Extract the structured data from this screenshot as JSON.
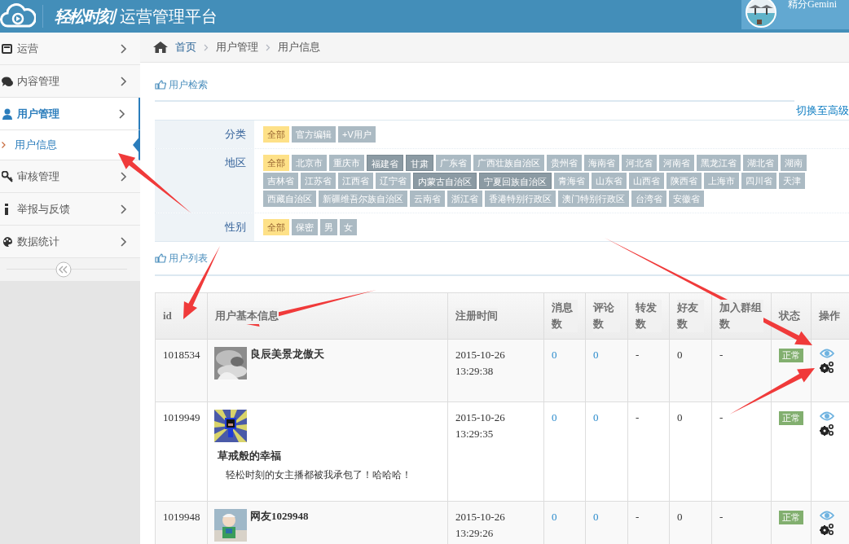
{
  "header": {
    "logo": "轻松时刻",
    "title": "运营管理平台",
    "user": "精分Gemini"
  },
  "sidebar": {
    "items": [
      {
        "label": "运营",
        "selected": false
      },
      {
        "label": "内容管理",
        "selected": false
      },
      {
        "label": "用户管理",
        "selected": true,
        "children": [
          {
            "label": "用户信息",
            "selected": true
          }
        ]
      },
      {
        "label": "审核管理",
        "selected": false
      },
      {
        "label": "举报与反馈",
        "selected": false
      },
      {
        "label": "数据统计",
        "selected": false
      }
    ]
  },
  "breadcrumb": [
    "首页",
    "用户管理",
    "用户信息"
  ],
  "search": {
    "title": "用户检索",
    "switch_link": "切换至高级",
    "filters": [
      {
        "label": "分类",
        "tags": [
          {
            "label": "全部",
            "kind": "all",
            "selected": true
          },
          {
            "label": "官方编辑",
            "kind": "option",
            "selected": false
          },
          {
            "label": "+V用户",
            "kind": "option",
            "selected": false
          }
        ]
      },
      {
        "label": "地区",
        "tags": [
          {
            "label": "全部",
            "kind": "all",
            "selected": true
          },
          {
            "label": "北京市",
            "kind": "option",
            "selected": false
          },
          {
            "label": "重庆市",
            "kind": "option",
            "selected": false
          },
          {
            "label": "福建省",
            "kind": "option",
            "selected": true
          },
          {
            "label": "甘肃",
            "kind": "option",
            "selected": true
          },
          {
            "label": "广东省",
            "kind": "option",
            "selected": false
          },
          {
            "label": "广西壮族自治区",
            "kind": "option",
            "selected": false
          },
          {
            "label": "贵州省",
            "kind": "option",
            "selected": false
          },
          {
            "label": "海南省",
            "kind": "option",
            "selected": false
          },
          {
            "label": "河北省",
            "kind": "option",
            "selected": false
          },
          {
            "label": "河南省",
            "kind": "option",
            "selected": false
          },
          {
            "label": "黑龙江省",
            "kind": "option",
            "selected": false
          },
          {
            "label": "湖北省",
            "kind": "option",
            "selected": false
          },
          {
            "label": "湖南",
            "kind": "option",
            "selected": false
          },
          {
            "label": "吉林省",
            "kind": "option",
            "selected": false
          },
          {
            "label": "江苏省",
            "kind": "option",
            "selected": false
          },
          {
            "label": "江西省",
            "kind": "option",
            "selected": false
          },
          {
            "label": "辽宁省",
            "kind": "option",
            "selected": false
          },
          {
            "label": "内蒙古自治区",
            "kind": "option",
            "selected": true
          },
          {
            "label": "宁夏回族自治区",
            "kind": "option",
            "selected": true
          },
          {
            "label": "青海省",
            "kind": "option",
            "selected": false
          },
          {
            "label": "山东省",
            "kind": "option",
            "selected": false
          },
          {
            "label": "山西省",
            "kind": "option",
            "selected": false
          },
          {
            "label": "陕西省",
            "kind": "option",
            "selected": false
          },
          {
            "label": "上海市",
            "kind": "option",
            "selected": false
          },
          {
            "label": "四川省",
            "kind": "option",
            "selected": false
          },
          {
            "label": "天津",
            "kind": "option",
            "selected": false
          },
          {
            "label": "西藏自治区",
            "kind": "option",
            "selected": false
          },
          {
            "label": "新疆维吾尔族自治区",
            "kind": "option",
            "selected": false
          },
          {
            "label": "云南省",
            "kind": "option",
            "selected": false
          },
          {
            "label": "浙江省",
            "kind": "option",
            "selected": false
          },
          {
            "label": "香港特别行政区",
            "kind": "option",
            "selected": false
          },
          {
            "label": "澳门特别行政区",
            "kind": "option",
            "selected": false
          },
          {
            "label": "台湾省",
            "kind": "option",
            "selected": false
          },
          {
            "label": "安徽省",
            "kind": "option",
            "selected": false
          }
        ]
      },
      {
        "label": "性别",
        "tags": [
          {
            "label": "全部",
            "kind": "all",
            "selected": true
          },
          {
            "label": "保密",
            "kind": "option",
            "selected": false
          },
          {
            "label": "男",
            "kind": "option",
            "selected": false
          },
          {
            "label": "女",
            "kind": "option",
            "selected": false
          }
        ]
      }
    ]
  },
  "list_title": "用户列表",
  "table": {
    "columns": [
      "id",
      "用户基本信息",
      "注册时间",
      "消息数",
      "评论数",
      "转发数",
      "好友数",
      "加入群组数",
      "状态",
      "操作"
    ],
    "rows": [
      {
        "id": "1018534",
        "name": "良辰美景龙傲天",
        "date": "2015-10-26",
        "time": "13:29:38",
        "messages": "0",
        "comments": "0",
        "forwards": "-",
        "friends": "0",
        "groups": "-",
        "status": "正常"
      },
      {
        "id": "1019949",
        "name": "草戒般的幸福",
        "bio": "轻松时刻的女主播都被我承包了！哈哈哈！",
        "date": "2015-10-26",
        "time": "13:29:35",
        "messages": "0",
        "comments": "0",
        "forwards": "-",
        "friends": "0",
        "groups": "-",
        "status": "正常"
      },
      {
        "id": "1019948",
        "name": "网友1029948",
        "date": "2015-10-26",
        "time": "13:29:26",
        "messages": "0",
        "comments": "0",
        "forwards": "-",
        "friends": "0",
        "groups": "-",
        "status": "正常"
      }
    ]
  }
}
